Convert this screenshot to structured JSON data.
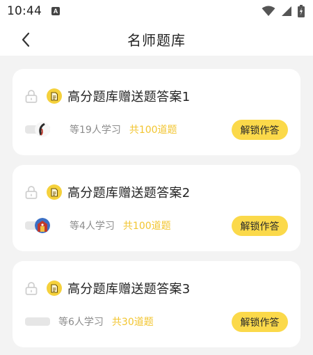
{
  "status_bar": {
    "time": "10:44",
    "notification_glyph": "A"
  },
  "nav": {
    "title": "名师题库"
  },
  "cards": [
    {
      "title": "高分题库赠送题答案1",
      "learners": "等19人学习",
      "count": "共100道题",
      "button": "解锁作答"
    },
    {
      "title": "高分题库赠送题答案2",
      "learners": "等4人学习",
      "count": "共100道题",
      "button": "解锁作答"
    },
    {
      "title": "高分题库赠送题答案3",
      "learners": "等6人学习",
      "count": "共30道题",
      "button": "解锁作答"
    }
  ],
  "colors": {
    "accent": "#fbd94a",
    "count_text": "#f2c530",
    "background": "#f3f3f3"
  }
}
